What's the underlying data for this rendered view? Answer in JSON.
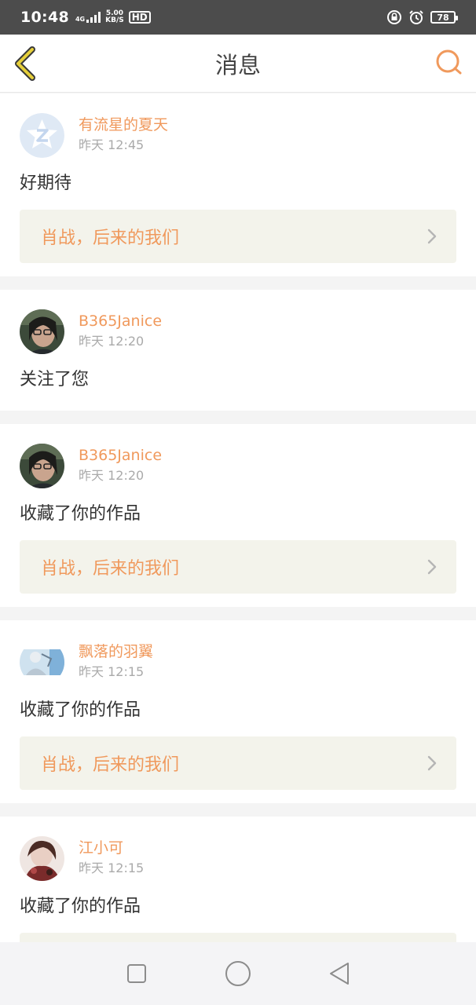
{
  "status_bar": {
    "time": "10:48",
    "network": "4G",
    "speed_value": "5.00",
    "speed_unit": "KB/S",
    "hd_label": "HD",
    "battery": "78"
  },
  "header": {
    "title": "消息",
    "back_icon": "chevron-left-icon",
    "search_icon": "search-icon"
  },
  "messages": [
    {
      "user": "有流星的夏天",
      "time": "昨天 12:45",
      "text": "好期待",
      "work": "肖战，后来的我们",
      "avatar": "qzone-default-avatar"
    },
    {
      "user": "B365Janice",
      "time": "昨天 12:20",
      "text": "关注了您",
      "work": null,
      "avatar": "photo-avatar"
    },
    {
      "user": "B365Janice",
      "time": "昨天 12:20",
      "text": "收藏了你的作品",
      "work": "肖战，后来的我们",
      "avatar": "photo-avatar"
    },
    {
      "user": "飘落的羽翼",
      "time": "昨天 12:15",
      "text": "收藏了你的作品",
      "work": "肖战，后来的我们",
      "avatar": "photo-avatar"
    },
    {
      "user": "江小可",
      "time": "昨天 12:15",
      "text": "收藏了你的作品",
      "work": "",
      "avatar": "photo-avatar"
    }
  ],
  "colors": {
    "accent": "#f0995c",
    "back_icon": "#c9b230",
    "card_bg": "#ffffff",
    "work_bg": "#f3f3eb"
  }
}
